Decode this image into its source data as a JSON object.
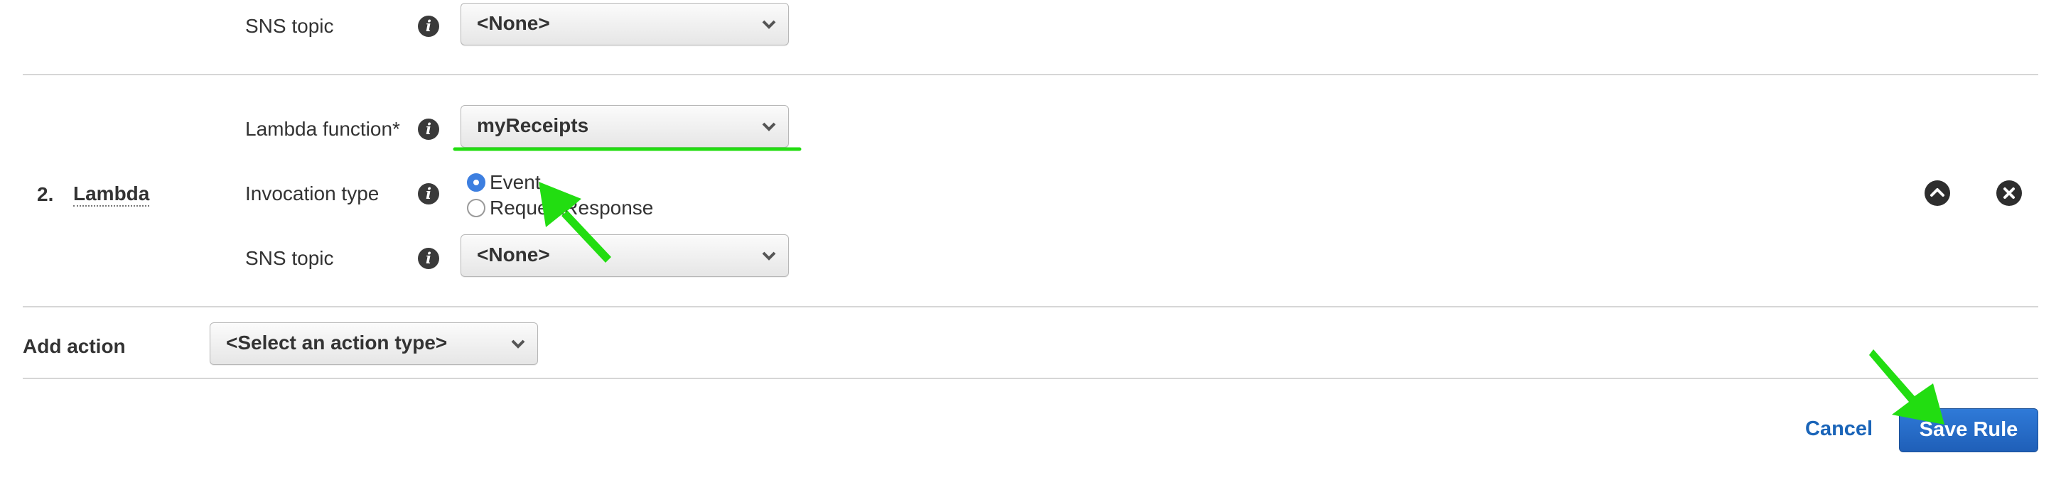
{
  "action1": {
    "sns_label": "SNS topic",
    "sns_value": "<None>"
  },
  "action2": {
    "number": "2.",
    "type_label": "Lambda",
    "lambda_label": "Lambda function*",
    "lambda_value": "myReceipts",
    "invocation_label": "Invocation type",
    "invocation_options": [
      "Event",
      "RequestResponse"
    ],
    "invocation_selected": "Event",
    "sns_label": "SNS topic",
    "sns_value": "<None>"
  },
  "add_action": {
    "label": "Add action",
    "select_value": "<Select an action type>"
  },
  "footer": {
    "cancel_label": "Cancel",
    "save_label": "Save Rule"
  },
  "colors": {
    "annotation": "#22dd11",
    "primary": "#2568c4",
    "link": "#1a64b8"
  },
  "icons": [
    "info-icon",
    "chevron-down-icon",
    "move-up-icon",
    "remove-icon",
    "annotation-arrow"
  ]
}
